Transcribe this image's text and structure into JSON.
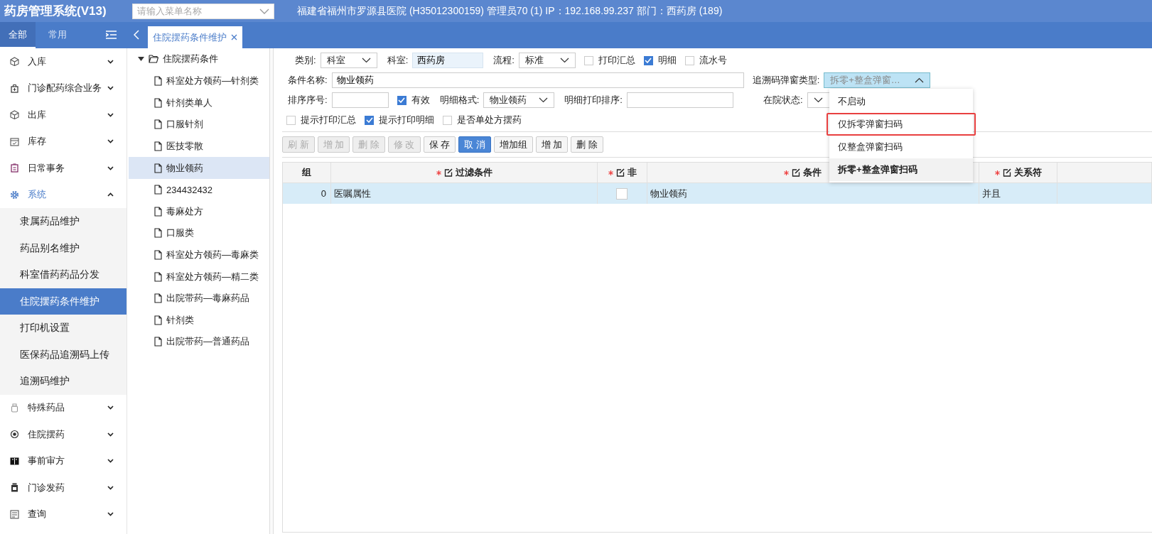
{
  "header": {
    "title": "药房管理系统(V13)",
    "search": {
      "placeholder": "请输入菜单名称"
    },
    "info": "福建省福州市罗源县医院 (H35012300159) 管理员70 (1) IP：192.168.99.237 部门：西药房 (189)"
  },
  "sidebar": {
    "tabs": [
      {
        "label": "全部",
        "selected": true
      },
      {
        "label": "常用",
        "selected": false
      }
    ],
    "items": [
      {
        "label": "入库",
        "expanded": false
      },
      {
        "label": "门诊配药综合业务",
        "expanded": false
      },
      {
        "label": "出库",
        "expanded": false
      },
      {
        "label": "库存",
        "expanded": false
      },
      {
        "label": "日常事务",
        "expanded": false
      },
      {
        "label": "系统",
        "expanded": true,
        "children": [
          {
            "label": "隶属药品维护",
            "selected": false
          },
          {
            "label": "药品别名维护",
            "selected": false
          },
          {
            "label": "科室借药药品分发",
            "selected": false
          },
          {
            "label": "住院摆药条件维护",
            "selected": true
          },
          {
            "label": "打印机设置",
            "selected": false
          },
          {
            "label": "医保药品追溯码上传",
            "selected": false
          },
          {
            "label": "追溯码维护",
            "selected": false
          }
        ]
      },
      {
        "label": "特殊药品",
        "expanded": false
      },
      {
        "label": "住院摆药",
        "expanded": false
      },
      {
        "label": "事前审方",
        "expanded": false
      },
      {
        "label": "门诊发药",
        "expanded": false
      },
      {
        "label": "查询",
        "expanded": false
      }
    ]
  },
  "open_tabs": [
    {
      "label": "住院摆药条件维护",
      "selected": true
    }
  ],
  "tree": {
    "label": "住院摆药条件",
    "expanded": true,
    "children": [
      {
        "label": "科室处方领药—针剂类",
        "selected": false
      },
      {
        "label": "针剂类单人",
        "selected": false
      },
      {
        "label": "口服针剂",
        "selected": false
      },
      {
        "label": "医技零散",
        "selected": false
      },
      {
        "label": "物业领药",
        "selected": true
      },
      {
        "label": "234432432",
        "selected": false
      },
      {
        "label": "毒麻处方",
        "selected": false
      },
      {
        "label": "口服类",
        "selected": false
      },
      {
        "label": "科室处方领药—毒麻类",
        "selected": false
      },
      {
        "label": "科室处方领药—精二类",
        "selected": false
      },
      {
        "label": "出院带药—毒麻药品",
        "selected": false
      },
      {
        "label": "针剂类",
        "selected": false
      },
      {
        "label": "出院带药—普通药品",
        "selected": false
      }
    ]
  },
  "form": {
    "rows": [
      [
        {
          "kind": "select",
          "label": "类别:",
          "value": "科室"
        },
        {
          "kind": "input",
          "label": "科室:",
          "value": "西药房",
          "readonly": true
        },
        {
          "kind": "select",
          "label": "流程:",
          "value": "标准"
        },
        {
          "kind": "check",
          "label": "打印汇总",
          "checked": false
        },
        {
          "kind": "check",
          "label": "明细",
          "checked": true
        },
        {
          "kind": "check",
          "label": "流水号",
          "checked": false
        }
      ],
      [
        {
          "kind": "input",
          "label": "条件名称:",
          "value": "物业领药",
          "readonly": false
        },
        {
          "kind": "select",
          "label": "追溯码弹窗类型:",
          "value": "拆零+整盒弹窗…",
          "expanded": true
        }
      ],
      [
        {
          "kind": "input",
          "label": "排序序号:",
          "readonly": false
        },
        {
          "kind": "check",
          "label": "有效",
          "checked": true
        },
        {
          "kind": "select",
          "label": "明细格式:",
          "value": "物业领药"
        },
        {
          "kind": "input",
          "label": "明细打印排序:",
          "readonly": false
        },
        {
          "kind": "select",
          "label": "在院状态:"
        }
      ],
      [
        {
          "kind": "check",
          "label": "提示打印汇总",
          "checked": false
        },
        {
          "kind": "check",
          "label": "提示打印明细",
          "checked": true
        },
        {
          "kind": "check",
          "label": "是否单处方摆药",
          "checked": false
        }
      ]
    ],
    "dropdown": [
      {
        "label": "不启动",
        "selected": false,
        "highlighted": false
      },
      {
        "label": "仅拆零弹窗扫码",
        "selected": false,
        "highlighted": true
      },
      {
        "label": "仅整盒弹窗扫码",
        "selected": false,
        "highlighted": false
      },
      {
        "label": "拆零+整盒弹窗扫码",
        "selected": true,
        "highlighted": false
      }
    ]
  },
  "toolbar": [
    {
      "label": "刷 新",
      "kind": "disabled"
    },
    {
      "label": "增 加",
      "kind": "disabled"
    },
    {
      "label": "删 除",
      "kind": "disabled"
    },
    {
      "label": "修 改",
      "kind": "disabled"
    },
    {
      "label": "保 存",
      "kind": "normal"
    },
    {
      "label": "取 消",
      "kind": "primary"
    },
    {
      "label": "增加组",
      "kind": "normal"
    },
    {
      "label": "增 加",
      "kind": "normal"
    },
    {
      "label": "删 除",
      "kind": "normal"
    }
  ],
  "table": {
    "columns": [
      {
        "label": "组",
        "required": false,
        "editable": false
      },
      {
        "label": "过滤条件",
        "required": true,
        "editable": true
      },
      {
        "label": "非",
        "required": true,
        "editable": true
      },
      {
        "label": "条件",
        "required": true,
        "editable": true
      },
      {
        "label": "关系符",
        "required": true,
        "editable": true
      },
      {}
    ],
    "rows": [
      {
        "selected": true,
        "cells": [
          {
            "kind": "num",
            "text": "0"
          },
          {
            "kind": "text",
            "text": "医嘱属性"
          },
          {
            "kind": "check",
            "checked": false
          },
          {
            "kind": "text",
            "text": "物业领药"
          },
          {
            "kind": "text",
            "text": "并且"
          },
          {
            "kind": "empty"
          }
        ]
      }
    ]
  }
}
